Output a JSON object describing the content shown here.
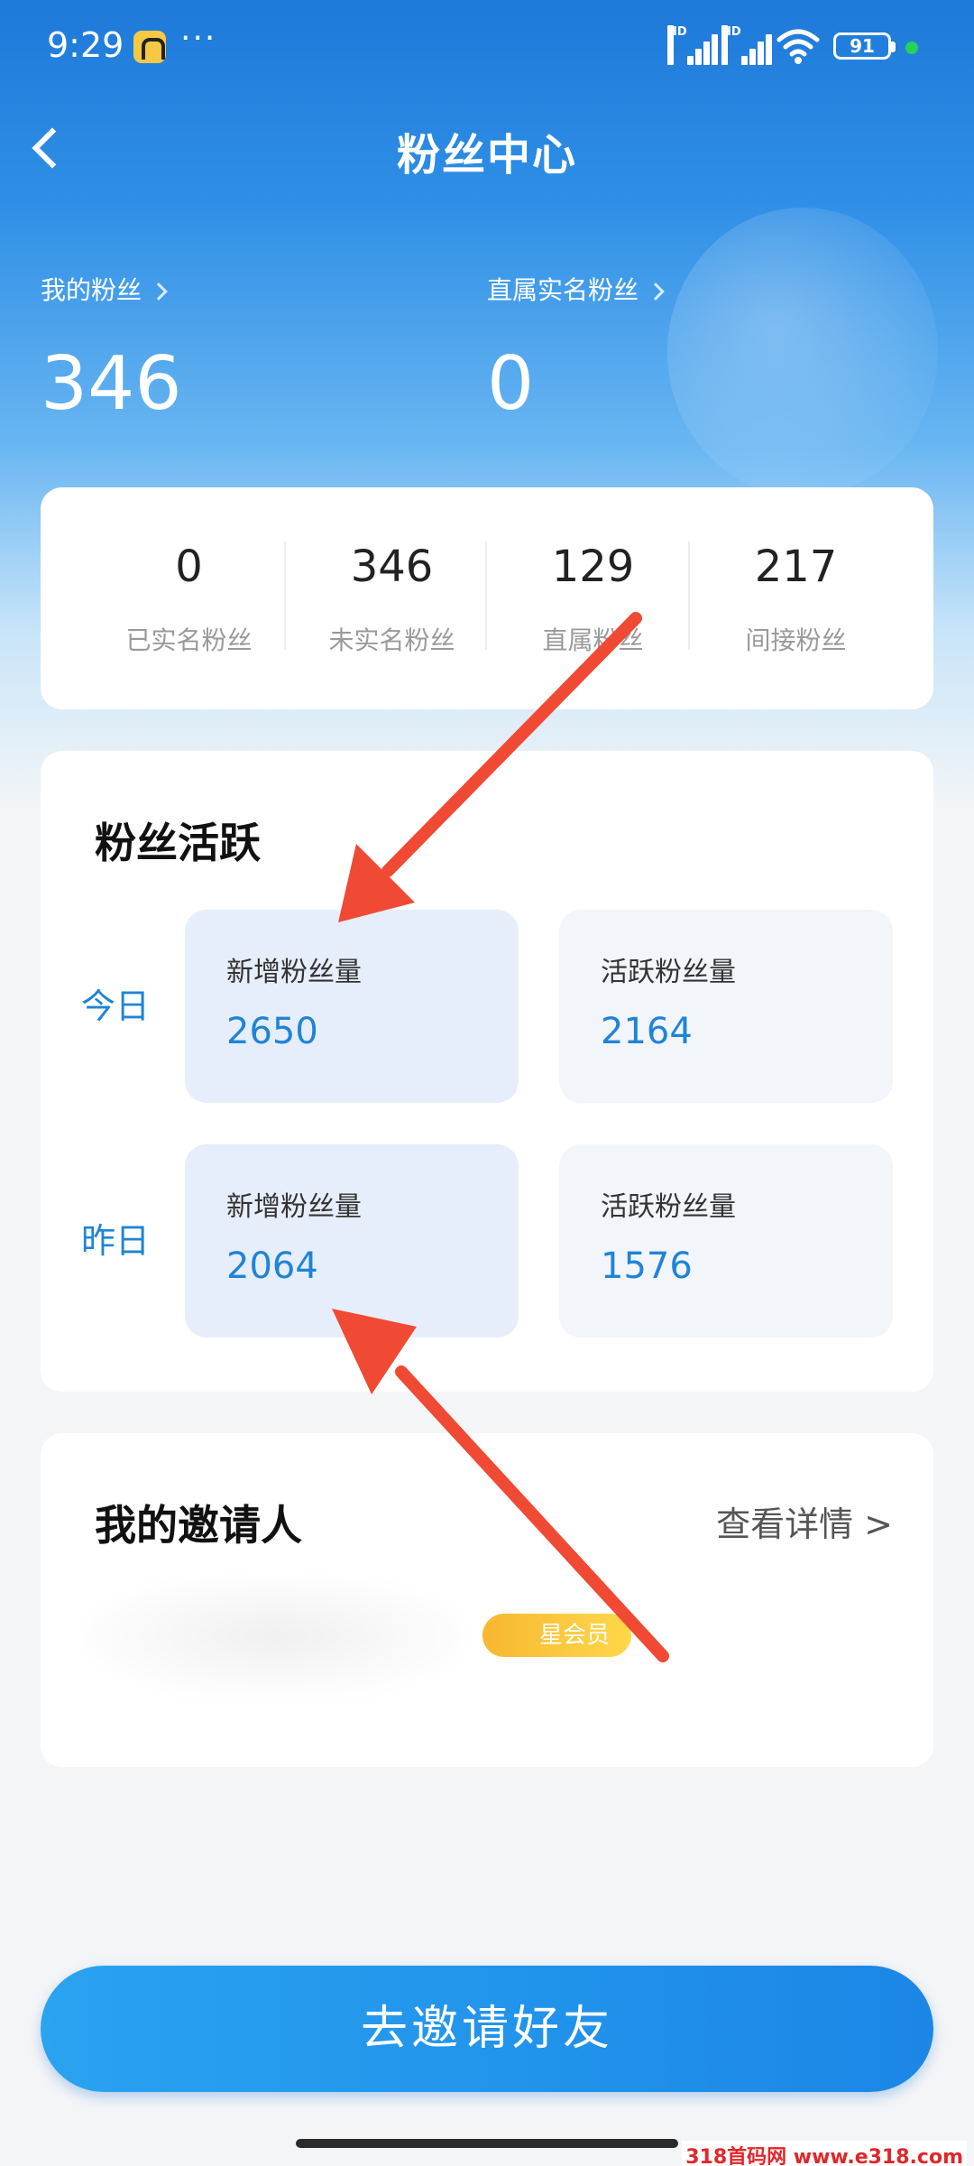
{
  "status_bar": {
    "time": "9:29",
    "overflow_dots": "···",
    "battery": "91",
    "hd_labels": [
      "HD",
      "HD"
    ]
  },
  "nav": {
    "title": "粉丝中心"
  },
  "hero": {
    "my_fans_label": "我的粉丝",
    "my_fans_value": "346",
    "direct_verified_label": "直属实名粉丝",
    "direct_verified_value": "0"
  },
  "stats": [
    {
      "value": "0",
      "label": "已实名粉丝"
    },
    {
      "value": "346",
      "label": "未实名粉丝"
    },
    {
      "value": "129",
      "label": "直属粉丝"
    },
    {
      "value": "217",
      "label": "间接粉丝"
    }
  ],
  "activity": {
    "title": "粉丝活跃",
    "today": {
      "label": "今日",
      "new_label": "新增粉丝量",
      "new_value": "2650",
      "active_label": "活跃粉丝量",
      "active_value": "2164"
    },
    "yesterday": {
      "label": "昨日",
      "new_label": "新增粉丝量",
      "new_value": "2064",
      "active_label": "活跃粉丝量",
      "active_value": "1576"
    }
  },
  "inviter": {
    "title": "我的邀请人",
    "detail_link": "查看详情 >",
    "badge": "星会员"
  },
  "invite_button": "去邀请好友",
  "watermark": "318首码网 www.e318.com",
  "colors": {
    "accent_blue": "#1f84d6",
    "arrow_red": "#f04a34",
    "badge_gold": "#f7b731"
  }
}
